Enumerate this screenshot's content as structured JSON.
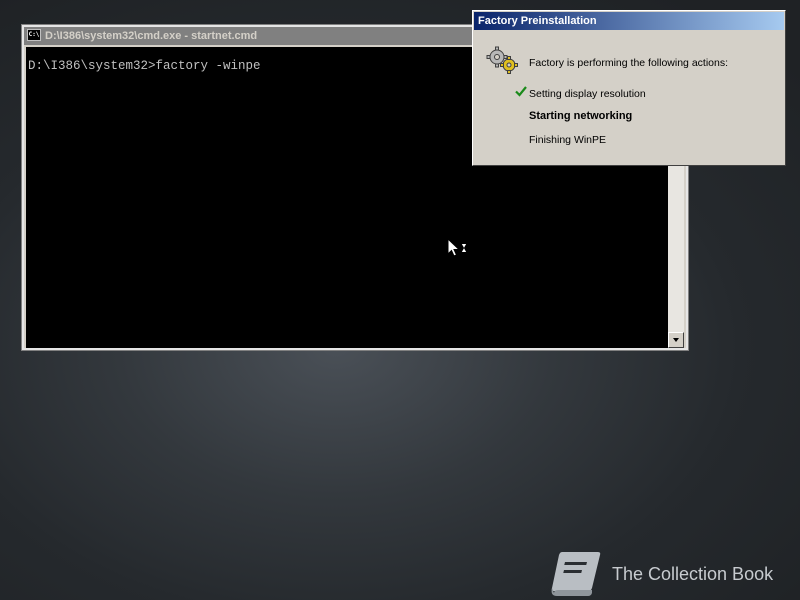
{
  "console_window": {
    "title": "D:\\I386\\system32\\cmd.exe - startnet.cmd",
    "icon_text": "C:\\",
    "prompt_line": "D:\\I386\\system32>factory -winpe"
  },
  "factory_dialog": {
    "title": "Factory Preinstallation",
    "message": "Factory is performing the following actions:",
    "steps": [
      {
        "label": "Setting display resolution",
        "status": "done"
      },
      {
        "label": "Starting networking",
        "status": "in-progress"
      },
      {
        "label": "Finishing WinPE",
        "status": "pending"
      }
    ]
  },
  "watermark": {
    "text": "The Collection Book"
  },
  "colors": {
    "console_background": "#000000",
    "console_text": "#c0c0c0",
    "dialog_title_start": "#0a246a",
    "dialog_title_end": "#a6caf0",
    "checkmark": "#1a8a1a"
  },
  "icons": {
    "console": "cmd-icon",
    "dialog": "gears-icon",
    "done_step": "check-icon",
    "cursor": "busy-cursor-icon",
    "watermark": "book-icon"
  }
}
